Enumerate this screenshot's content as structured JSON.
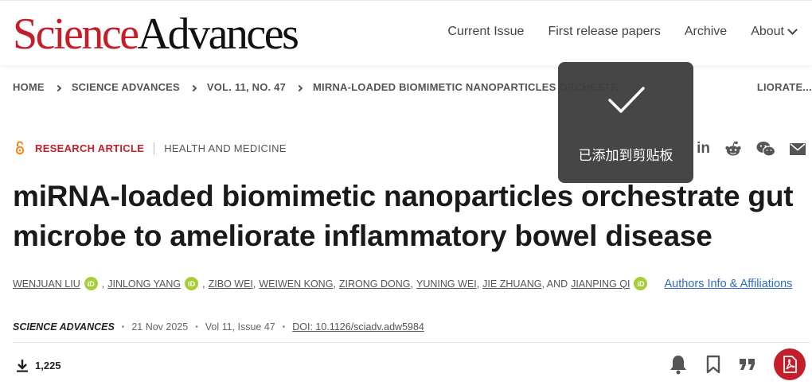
{
  "header": {
    "logo_science": "Science",
    "logo_advances": "Advances",
    "nav": [
      "Current Issue",
      "First release papers",
      "Archive"
    ],
    "nav_about": "About"
  },
  "breadcrumb": [
    "HOME",
    "SCIENCE ADVANCES",
    "VOL. 11, NO. 47",
    "MIRNA-LOADED BIOMIMETIC NANOPARTICLES ORCHESTR",
    "LIORATE..."
  ],
  "article": {
    "type": "RESEARCH ARTICLE",
    "subject": "HEALTH AND MEDICINE",
    "title": "miRNA-loaded biomimetic nanoparticles orchestrate gut microbe to ameliorate inflammatory bowel disease",
    "authors": {
      "a1": "WENJUAN LIU",
      "a2": "JINLONG YANG",
      "a3": "ZIBO WEI",
      "a4": "WEIWEN KONG",
      "a5": "ZIRONG DONG",
      "a6": "YUNING WEI",
      "a7": "JIE ZHUANG",
      "and": ", AND",
      "a8": "JIANPING QI",
      "comma": ",",
      "orcid": "iD"
    },
    "affiliations_link": "Authors Info & Affiliations",
    "journal": "SCIENCE ADVANCES",
    "date": "21 Nov 2025",
    "volume": "Vol 11, Issue 47",
    "doi": "DOI: 10.1126/sciadv.adw5984",
    "downloads": "1,225"
  },
  "share": {
    "linkedin": "in"
  },
  "toast": {
    "message": "已添加到剪贴板"
  },
  "colors": {
    "brand_red": "#c41e2a",
    "orcid_green": "#a6ce39",
    "link_blue": "#2d6bc4",
    "toast_bg": "#3e3e3e"
  },
  "icons": [
    "open-access-icon",
    "linkedin-icon",
    "reddit-icon",
    "wechat-icon",
    "email-icon",
    "download-icon",
    "bell-icon",
    "bookmark-icon",
    "quote-icon",
    "pdf-icon",
    "checkmark-icon",
    "chevron-down-icon"
  ]
}
